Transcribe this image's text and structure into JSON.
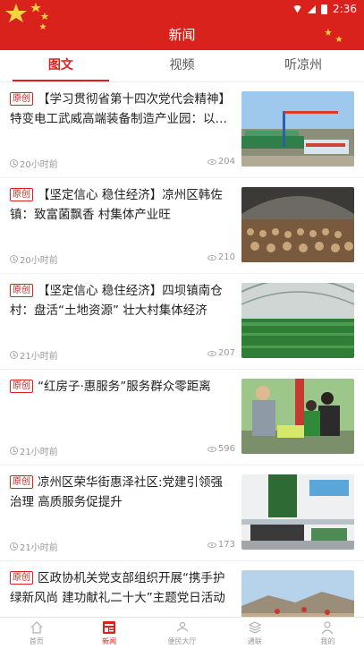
{
  "status_bar": {
    "time": "2:36"
  },
  "header": {
    "title": "新闻"
  },
  "tabs": [
    {
      "label": "图文",
      "active": true
    },
    {
      "label": "视频",
      "active": false
    },
    {
      "label": "听凉州",
      "active": false
    }
  ],
  "articles": [
    {
      "badge": "原创",
      "title": "【学习贯彻省第十四次党代会精神】特变电工武威高端装备制造产业园：以…",
      "time": "20小时前",
      "views": "204",
      "image": "industrial-park-crane-photo"
    },
    {
      "badge": "原创",
      "title": "【坚定信心 稳住经济】凉州区韩佐镇：致富菌飘香 村集体产业旺",
      "time": "20小时前",
      "views": "210",
      "image": "mushroom-greenhouse-photo"
    },
    {
      "badge": "原创",
      "title": "【坚定信心 稳住经济】四坝镇南仓村：盘活“土地资源” 壮大村集体经济",
      "time": "21小时前",
      "views": "207",
      "image": "seedling-greenhouse-photo"
    },
    {
      "badge": "原创",
      "title": "“红房子·惠服务”服务群众零距离",
      "time": "21小时前",
      "views": "596",
      "image": "service-volunteers-photo"
    },
    {
      "badge": "原创",
      "title": "凉州区荣华街惠泽社区:党建引领强治理 高质服务促提升",
      "time": "21小时前",
      "views": "173",
      "image": "community-office-photo"
    },
    {
      "badge": "原创",
      "title": "区政协机关党支部组织开展“携手护绿新风尚 建功献礼二十大”主题党日活动",
      "time": "",
      "views": "",
      "image": "tree-planting-photo"
    }
  ],
  "bottom_nav": [
    {
      "label": "首页",
      "icon": "home-icon",
      "active": false
    },
    {
      "label": "新闻",
      "icon": "news-icon",
      "active": true
    },
    {
      "label": "便民大厅",
      "icon": "service-hall-icon",
      "active": false
    },
    {
      "label": "通联",
      "icon": "contact-icon",
      "active": false
    },
    {
      "label": "我的",
      "icon": "profile-icon",
      "active": false
    }
  ],
  "colors": {
    "brand_red": "#d9221c",
    "meta_gray": "#999999"
  }
}
